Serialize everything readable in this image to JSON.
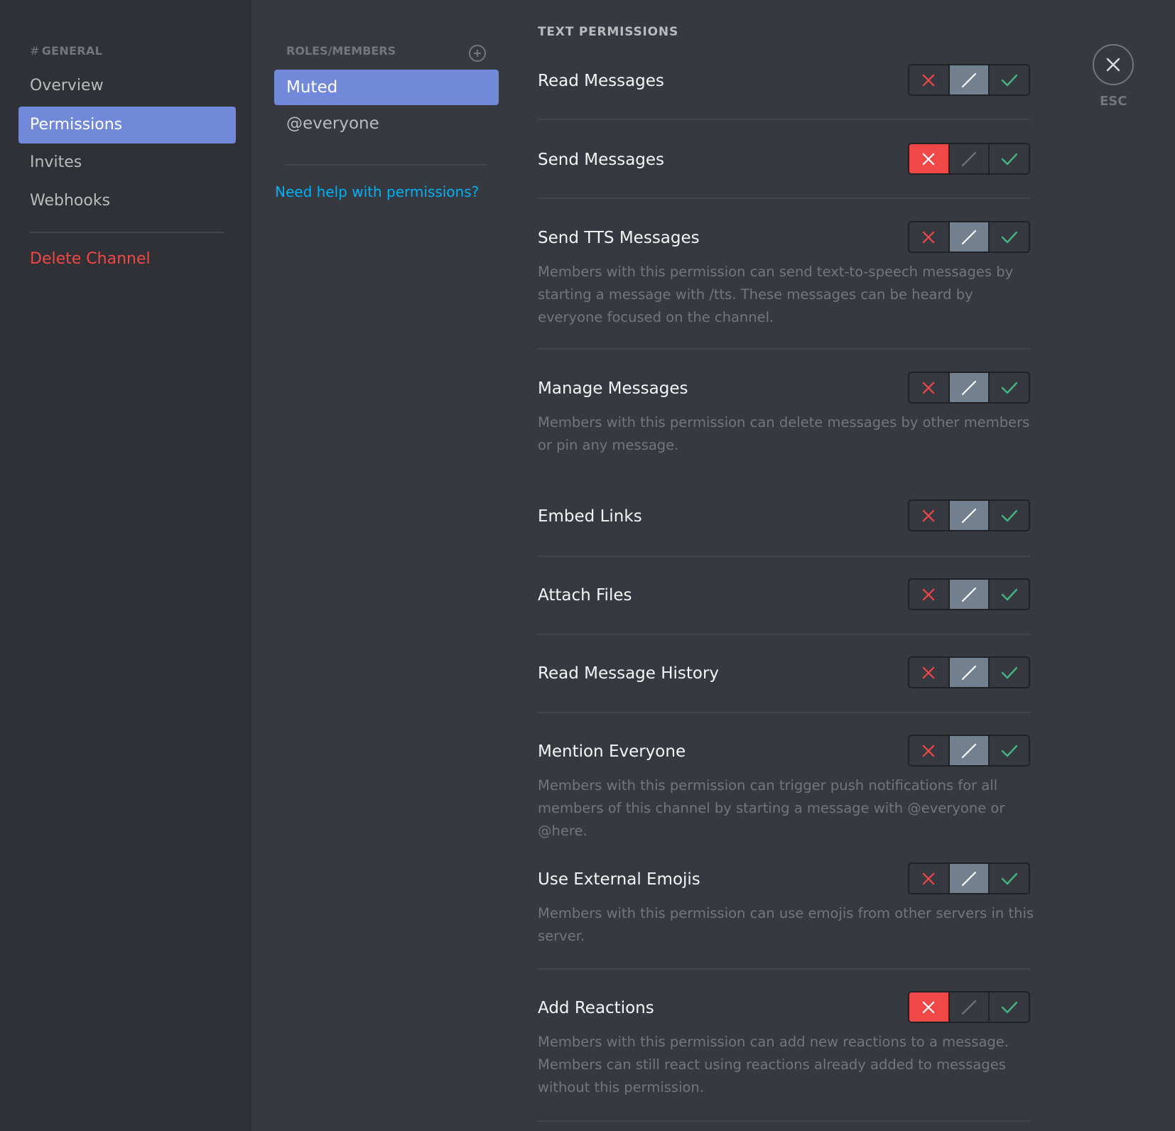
{
  "sidebar": {
    "header_hash": "#",
    "header": "GENERAL",
    "items": [
      {
        "label": "Overview",
        "active": false
      },
      {
        "label": "Permissions",
        "active": true
      },
      {
        "label": "Invites",
        "active": false
      },
      {
        "label": "Webhooks",
        "active": false
      }
    ],
    "delete_label": "Delete Channel"
  },
  "roles": {
    "header": "ROLES/MEMBERS",
    "add_icon": "plus-circle-icon",
    "items": [
      {
        "label": "Muted",
        "active": true
      },
      {
        "label": "@everyone",
        "active": false
      }
    ],
    "help_link": "Need help with permissions?"
  },
  "section_title": "TEXT PERMISSIONS",
  "permissions": [
    {
      "title": "Read Messages",
      "description": "",
      "state": "neutral"
    },
    {
      "title": "Send Messages",
      "description": "",
      "state": "deny"
    },
    {
      "title": "Send TTS Messages",
      "description": "Members with this permission can send text-to-speech messages by starting a message with /tts. These messages can be heard by everyone focused on the channel.",
      "state": "neutral"
    },
    {
      "title": "Manage Messages",
      "description": "Members with this permission can delete messages by other members or pin any message.",
      "state": "neutral"
    },
    {
      "title": "Embed Links",
      "description": "",
      "state": "neutral"
    },
    {
      "title": "Attach Files",
      "description": "",
      "state": "neutral"
    },
    {
      "title": "Read Message History",
      "description": "",
      "state": "neutral"
    },
    {
      "title": "Mention Everyone",
      "description": "Members with this permission can trigger push notifications for all members of this channel by starting a message with @everyone or @here.",
      "state": "neutral"
    },
    {
      "title": "Use External Emojis",
      "description": "Members with this permission can use emojis from other servers in this server.",
      "state": "neutral"
    },
    {
      "title": "Add Reactions",
      "description": "Members with this permission can add new reactions to a message. Members can still react using reactions already added to messages without this permission.",
      "state": "deny"
    }
  ],
  "toggle_icons": {
    "deny": "x-icon",
    "neutral": "slash-icon",
    "allow": "check-icon"
  },
  "colors": {
    "accent": "#7289da",
    "deny": "#f04747",
    "allow": "#43b581",
    "neutral_selected": "#72808f",
    "link": "#00b0f4"
  },
  "close": {
    "icon": "close-icon",
    "label": "ESC"
  }
}
